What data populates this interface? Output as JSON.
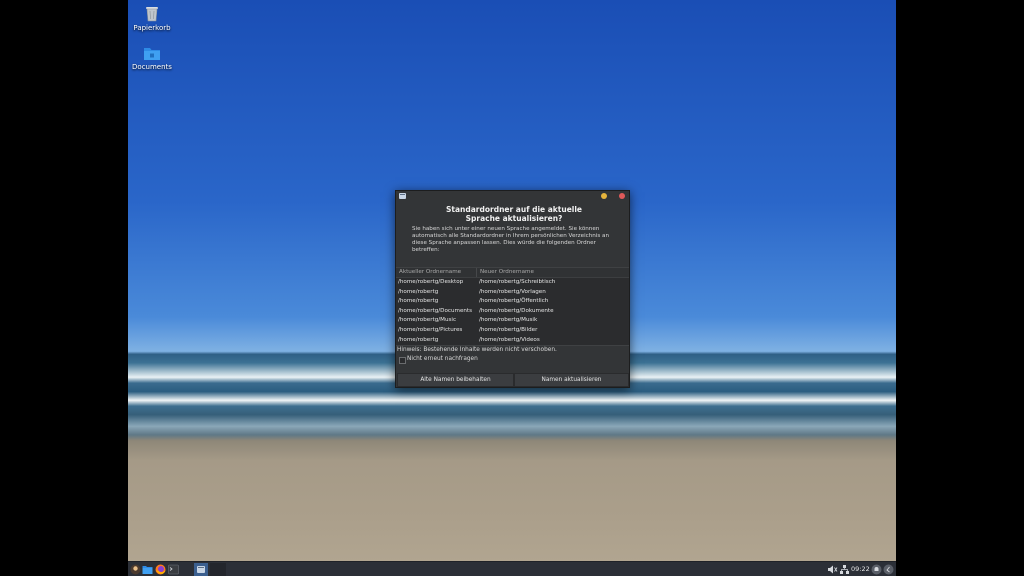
{
  "desktop": {
    "icons": [
      {
        "label": "Papierkorb",
        "icon": "trash-icon"
      },
      {
        "label": "Documents",
        "icon": "folder-icon"
      }
    ]
  },
  "dialog": {
    "heading_line1": "Standardordner auf die aktuelle",
    "heading_line2": "Sprache aktualisieren?",
    "description": "Sie haben sich unter einer neuen Sprache angemeldet. Sie können automatisch alle Standardordner in Ihrem persönlichen Verzeichnis an diese Sprache anpassen lassen. Dies würde die folgenden Ordner betreffen:",
    "table": {
      "headers": [
        "Aktueller Ordnername",
        "Neuer Ordnername"
      ],
      "rows": [
        [
          "/home/robertg/Desktop",
          "/home/robertg/Schreibtisch"
        ],
        [
          "/home/robertg",
          "/home/robertg/Vorlagen"
        ],
        [
          "/home/robertg",
          "/home/robertg/Öffentlich"
        ],
        [
          "/home/robertg/Documents",
          "/home/robertg/Dokumente"
        ],
        [
          "/home/robertg/Music",
          "/home/robertg/Musik"
        ],
        [
          "/home/robertg/Pictures",
          "/home/robertg/Bilder"
        ],
        [
          "/home/robertg",
          "/home/robertg/Videos"
        ]
      ]
    },
    "note": "Hinweis: Bestehende Inhalte werden nicht verschoben.",
    "checkbox_label": "Nicht erneut nachfragen",
    "buttons": {
      "keep": "Alte Namen beibehalten",
      "update": "Namen aktualisieren"
    }
  },
  "taskbar": {
    "clock": "09:22",
    "launchers": [
      "whisker-menu-icon",
      "file-manager-icon",
      "firefox-icon",
      "terminal-icon"
    ],
    "tray": [
      "volume-muted-icon",
      "network-icon",
      "notification-icon",
      "power-icon"
    ]
  },
  "colors": {
    "dialog_bg": "#333537",
    "taskbar_bg": "#2b2f37",
    "minimize": "#e6b43c",
    "close": "#e05a5a"
  }
}
